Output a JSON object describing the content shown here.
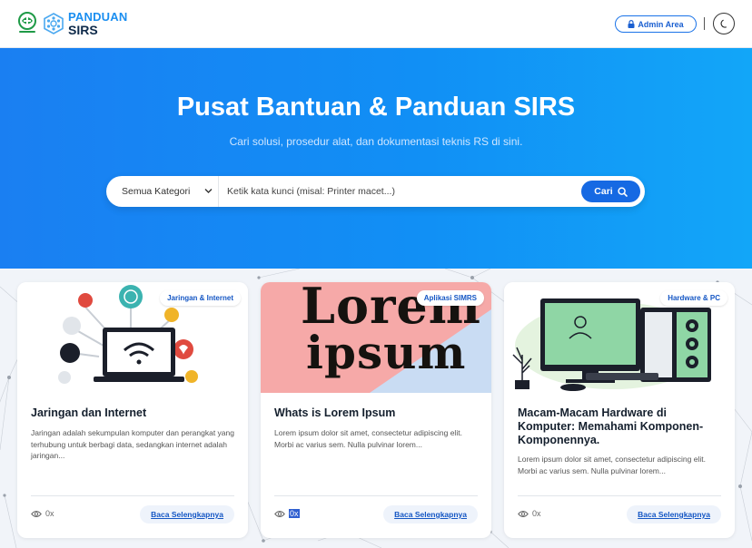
{
  "header": {
    "brand_line1": "PANDUAN",
    "brand_line2": "SIRS",
    "admin_label": "Admin Area"
  },
  "hero": {
    "title": "Pusat Bantuan & Panduan SIRS",
    "subtitle": "Cari solusi, prosedur alat, dan dokumentasi teknis RS di sini.",
    "category_selected": "Semua Kategori",
    "search_placeholder": "Ketik kata kunci (misal: Printer macet...)",
    "search_button": "Cari"
  },
  "cards": [
    {
      "badge": "Jaringan & Internet",
      "title": "Jaringan dan Internet",
      "description": "Jaringan adalah sekumpulan komputer dan perangkat yang terhubung untuk berbagi data, sedangkan internet adalah jaringan...",
      "views": "0x",
      "read_more": "Baca Selengkapnya"
    },
    {
      "badge": "Aplikasi SIMRS",
      "image_text_line1": "Lorem",
      "image_text_line2": "ipsum",
      "title": "Whats is Lorem Ipsum",
      "description": "Lorem ipsum dolor sit amet, consectetur adipiscing elit. Morbi ac varius sem. Nulla pulvinar lorem...",
      "views": "0x",
      "read_more": "Baca Selengkapnya"
    },
    {
      "badge": "Hardware & PC",
      "title": "Macam-Macam Hardware di Komputer: Memahami Komponen-Komponennya.",
      "description": "Lorem ipsum dolor sit amet, consectetur adipiscing elit. Morbi ac varius sem. Nulla pulvinar lorem...",
      "views": "0x",
      "read_more": "Baca Selengkapnya"
    }
  ],
  "colors": {
    "primary": "#1669e3",
    "hero_start": "#1a7ff2",
    "hero_end": "#12a6f8",
    "brand_blue": "#1a8ef0"
  }
}
